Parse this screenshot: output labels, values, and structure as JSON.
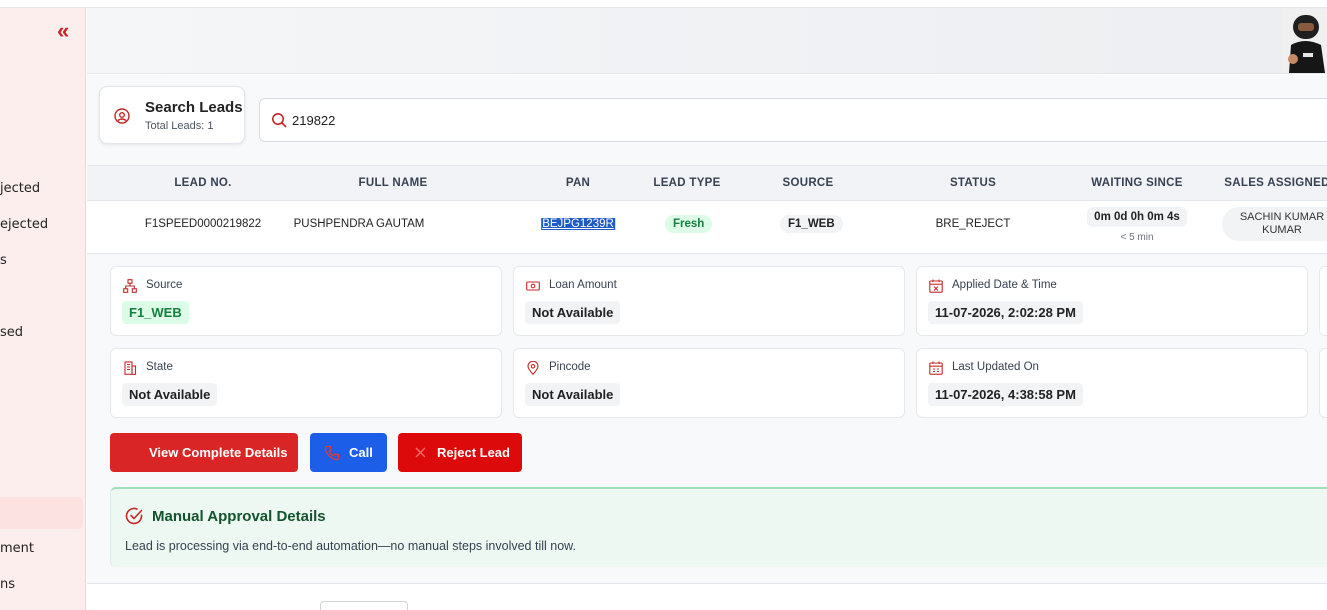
{
  "sidebar": {
    "items": [
      {
        "label": "jected"
      },
      {
        "label": "ejected"
      },
      {
        "label": "s"
      },
      {
        "label": "sed"
      },
      {
        "label": "ment"
      },
      {
        "label": "ns"
      }
    ]
  },
  "search_card": {
    "title": "Search Leads",
    "subtitle": "Total Leads: 1"
  },
  "search": {
    "value": "219822"
  },
  "table": {
    "headers": [
      "LEAD NO.",
      "FULL NAME",
      "PAN",
      "LEAD TYPE",
      "SOURCE",
      "STATUS",
      "WAITING SINCE",
      "SALES ASSIGNED"
    ],
    "row": {
      "lead_no": "F1SPEED0000219822",
      "full_name": "PUSHPENDRA GAUTAM",
      "pan": "BEJPG1239R",
      "lead_type": "Fresh",
      "source": "F1_WEB",
      "status": "BRE_REJECT",
      "waiting": "0m 0d 0h 0m 4s",
      "waiting_sub": "< 5 min",
      "sales_line1": "SACHIN KUMAR",
      "sales_line2": "KUMAR"
    }
  },
  "details": {
    "source": {
      "label": "Source",
      "value": "F1_WEB"
    },
    "loan_amount": {
      "label": "Loan Amount",
      "value": "Not Available"
    },
    "applied": {
      "label": "Applied Date & Time",
      "value": "11-07-2026, 2:02:28 PM"
    },
    "state": {
      "label": "State",
      "value": "Not Available"
    },
    "pincode": {
      "label": "Pincode",
      "value": "Not Available"
    },
    "updated": {
      "label": "Last Updated On",
      "value": "11-07-2026, 4:38:58 PM"
    }
  },
  "actions": {
    "view": "View Complete Details",
    "call": "Call",
    "reject": "Reject Lead"
  },
  "manual": {
    "title": "Manual Approval Details",
    "text": "Lead is processing via end-to-end automation—no manual steps involved till now."
  },
  "icons": {
    "collapse": "double-chevron-left-icon",
    "search": "search-icon",
    "user": "user-circle-icon",
    "source": "sitemap-icon",
    "loan": "banknote-icon",
    "calendar": "calendar-icon",
    "state": "building-icon",
    "pincode": "map-pin-icon",
    "phone": "phone-icon",
    "close": "close-icon",
    "check": "check-circle-icon"
  },
  "colors": {
    "brand_red": "#d92525",
    "call_blue": "#1d5ee8",
    "success_green": "#15803d"
  }
}
